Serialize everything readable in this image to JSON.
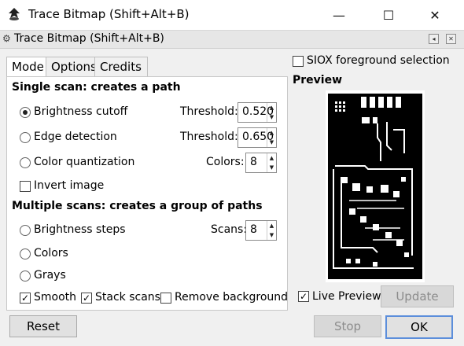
{
  "window": {
    "title": "Trace Bitmap (Shift+Alt+B)",
    "controls": {
      "minimize": "—",
      "maximize": "☐",
      "close": "✕"
    }
  },
  "dock": {
    "title": "Trace Bitmap (Shift+Alt+B)",
    "iconify": "◂",
    "close": "✕"
  },
  "tabs": [
    {
      "label": "Mode"
    },
    {
      "label": "Options"
    },
    {
      "label": "Credits"
    }
  ],
  "single_scan": {
    "heading": "Single scan: creates a path",
    "brightness": {
      "label": "Brightness cutoff",
      "selected": true,
      "param_label": "Threshold:",
      "value": "0.520"
    },
    "edge": {
      "label": "Edge detection",
      "selected": false,
      "param_label": "Threshold:",
      "value": "0.650"
    },
    "color_quant": {
      "label": "Color quantization",
      "selected": false,
      "param_label": "Colors:",
      "value": "8"
    },
    "invert": {
      "label": "Invert image",
      "checked": false
    }
  },
  "multi_scan": {
    "heading": "Multiple scans: creates a group of paths",
    "brightness_steps": {
      "label": "Brightness steps",
      "selected": false,
      "param_label": "Scans:",
      "value": "8"
    },
    "colors": {
      "label": "Colors",
      "selected": false
    },
    "grays": {
      "label": "Grays",
      "selected": false
    },
    "smooth": {
      "label": "Smooth",
      "checked": true
    },
    "stack": {
      "label": "Stack scans",
      "checked": true
    },
    "remove_bg": {
      "label": "Remove background",
      "checked": false
    }
  },
  "siox": {
    "label": "SIOX foreground selection",
    "checked": false
  },
  "preview": {
    "heading": "Preview",
    "live_label": "Live Preview",
    "live_checked": true,
    "update_label": "Update"
  },
  "buttons": {
    "reset": "Reset",
    "stop": "Stop",
    "ok": "OK"
  }
}
